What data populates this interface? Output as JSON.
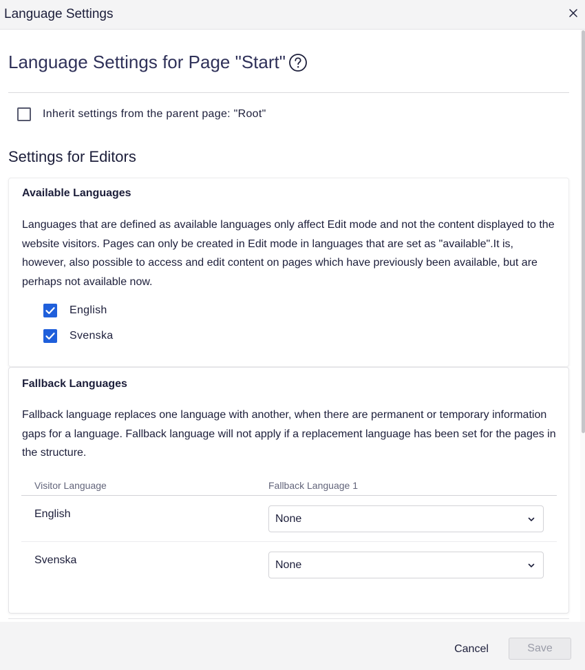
{
  "dialog": {
    "title": "Language Settings",
    "close_icon": "close-icon"
  },
  "page": {
    "heading": "Language Settings for Page \"Start\"",
    "help_icon": "question-circle-icon",
    "inherit_label": "Inherit settings from the parent page: \"Root\"",
    "inherit_checked": false,
    "section_heading": "Settings for Editors"
  },
  "available_languages": {
    "title": "Available Languages",
    "description": "Languages that are defined as available languages only affect Edit mode and not the content displayed to the website visitors. Pages can only be created in Edit mode in languages that are set as \"available\".It is, however, also possible to access and edit content on pages which have previously been available, but are perhaps not available now.",
    "languages": [
      {
        "label": "English",
        "checked": true
      },
      {
        "label": "Svenska",
        "checked": true
      }
    ]
  },
  "fallback_languages": {
    "title": "Fallback Languages",
    "description": "Fallback language replaces one language with another, when there are permanent or temporary information gaps for a language. Fallback language will not apply if a replacement language has been set for the pages in the structure.",
    "columns": [
      "Visitor Language",
      "Fallback Language 1"
    ],
    "rows": [
      {
        "language": "English",
        "fallback": "None"
      },
      {
        "language": "Svenska",
        "fallback": "None"
      }
    ]
  },
  "footer": {
    "cancel_label": "Cancel",
    "save_label": "Save",
    "save_enabled": false
  },
  "colors": {
    "accent": "#1f5fdb",
    "header_background": "#f4f4f5",
    "text": "#1c1e3a"
  }
}
